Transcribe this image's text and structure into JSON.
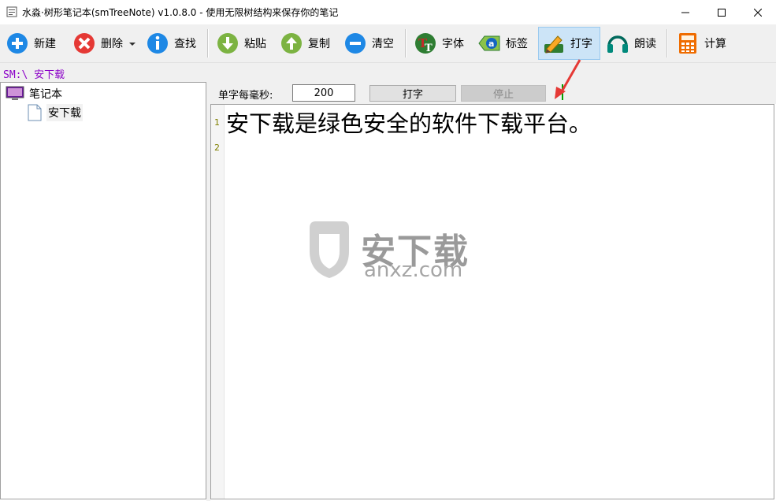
{
  "window": {
    "title": "水淼·树形笔记本(smTreeNote) v1.0.8.0 - 使用无限树结构来保存你的笔记",
    "controls": [
      "minimize-icon",
      "maximize-icon",
      "close-icon"
    ]
  },
  "toolbar": {
    "buttons": [
      {
        "label": "新建",
        "icon": "plus-circle-icon",
        "color": "#1e88e5"
      },
      {
        "label": "删除",
        "icon": "x-circle-icon",
        "color": "#e53935"
      },
      {
        "label": "查找",
        "icon": "info-circle-icon",
        "color": "#1e88e5"
      },
      {
        "label": "粘贴",
        "icon": "arrow-down-circle-icon",
        "color": "#7cb342"
      },
      {
        "label": "复制",
        "icon": "arrow-up-circle-icon",
        "color": "#7cb342"
      },
      {
        "label": "清空",
        "icon": "minus-circle-icon",
        "color": "#1e88e5"
      },
      {
        "label": "字体",
        "icon": "font-icon",
        "color": "#c62828"
      },
      {
        "label": "标签",
        "icon": "tag-icon",
        "color": "#2e7d32"
      },
      {
        "label": "打字",
        "icon": "pencil-icon",
        "color": "#f9a825"
      },
      {
        "label": "朗读",
        "icon": "headphones-icon",
        "color": "#00897b"
      },
      {
        "label": "计算",
        "icon": "calculator-icon",
        "color": "#ef6c00"
      }
    ],
    "active": "打字"
  },
  "path": "SM:\\ 安下载",
  "tree": {
    "root": "笔记本",
    "children": [
      "安下载"
    ]
  },
  "typing": {
    "ms_label": "单字每毫秒:",
    "ms_value": "200",
    "type_button": "打字",
    "stop_button": "停止"
  },
  "editor": {
    "line_numbers": [
      "1",
      "2"
    ],
    "content": "安下载是绿色安全的软件下载平台。"
  },
  "watermark": {
    "brand": "安下载",
    "domain": "anxz.com"
  }
}
